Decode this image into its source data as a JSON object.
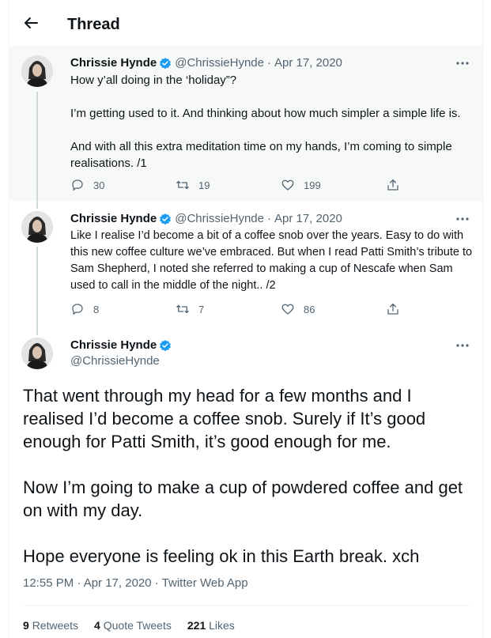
{
  "header": {
    "title": "Thread"
  },
  "tweets": [
    {
      "name": "Chrissie Hynde",
      "handle": "@ChrissieHynde",
      "date": "Apr 17, 2020",
      "text": "How y’all doing in the ‘holiday”?\n\nI’m getting used to it.  And thinking about how much simpler a simple life is.\n\nAnd with all this extra meditation time on my hands, I’m coming to simple realisations.  /1",
      "replies": "30",
      "retweets": "19",
      "likes": "199"
    },
    {
      "name": "Chrissie Hynde",
      "handle": "@ChrissieHynde",
      "date": "Apr 17, 2020",
      "text": "Like I realise I’d become a bit of a coffee snob over the years. Easy to do with this new coffee culture we’ve embraced. But when I read Patti Smith’s tribute to Sam Shepherd, I noted  she referred to making a cup of Nescafe when Sam used to call in the middle of the night.. /2",
      "replies": "8",
      "retweets": "7",
      "likes": "86"
    }
  ],
  "main_tweet": {
    "name": "Chrissie Hynde",
    "handle": "@ChrissieHynde",
    "text": "That went through my head for a few months and I realised I’d become a coffee snob.  Surely if It’s good enough for Patti Smith, it’s good enough for me.\n\nNow I’m going to make a cup of powdered coffee and get on with my day.\n\nHope everyone is feeling ok in this Earth break. xch",
    "meta": "12:55 PM · Apr 17, 2020 · Twitter Web App",
    "stats": [
      {
        "count": "9",
        "label": "Retweets"
      },
      {
        "count": "4",
        "label": "Quote Tweets"
      },
      {
        "count": "221",
        "label": "Likes"
      }
    ]
  },
  "colors": {
    "verified": "#1d9bf0",
    "secondary": "#536471",
    "highlight_bg": "#f7f9f9"
  },
  "icons": [
    "back-arrow-icon",
    "verified-badge-icon",
    "more-icon",
    "reply-icon",
    "retweet-icon",
    "like-icon",
    "share-icon"
  ]
}
